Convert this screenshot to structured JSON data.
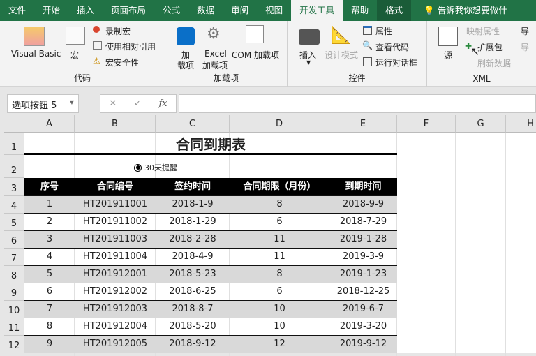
{
  "tabs": [
    "文件",
    "开始",
    "插入",
    "页面布局",
    "公式",
    "数据",
    "审阅",
    "视图",
    "开发工具",
    "帮助",
    "格式"
  ],
  "tell_me": "告诉我你想要做什",
  "ribbon": {
    "code": {
      "label": "代码",
      "visual_basic": "Visual Basic",
      "macro": "宏",
      "record_macro": "录制宏",
      "relative_ref": "使用相对引用",
      "macro_security": "宏安全性"
    },
    "addins": {
      "label": "加载项",
      "addins_1": "加",
      "addins_2": "载项",
      "excel_addins_1": "Excel",
      "excel_addins_2": "加载项",
      "com_addins": "COM 加载项"
    },
    "controls": {
      "label": "控件",
      "insert": "插入",
      "design_mode": "设计模式",
      "properties": "属性",
      "view_code": "查看代码",
      "run_dialog": "运行对话框"
    },
    "xml": {
      "label": "XML",
      "source": "源",
      "map_properties": "映射属性",
      "expansion_packs": "扩展包",
      "refresh_data": "刷新数据",
      "import": "导",
      "export": "导"
    }
  },
  "name_box": "选项按钮 5",
  "fx": "fx",
  "columns": [
    "A",
    "B",
    "C",
    "D",
    "E",
    "F",
    "G",
    "H"
  ],
  "rows": [
    "1",
    "2",
    "3",
    "4",
    "5",
    "6",
    "7",
    "8",
    "9",
    "10",
    "11",
    "12"
  ],
  "sheet": {
    "title": "合同到期表",
    "option_button": "30天提醒",
    "headers": [
      "序号",
      "合同编号",
      "签约时间",
      "合同期限（月份）",
      "到期时间"
    ],
    "data": [
      [
        "1",
        "HT201911001",
        "2018-1-9",
        "8",
        "2018-9-9"
      ],
      [
        "2",
        "HT201911002",
        "2018-1-29",
        "6",
        "2018-7-29"
      ],
      [
        "3",
        "HT201911003",
        "2018-2-28",
        "11",
        "2019-1-28"
      ],
      [
        "4",
        "HT201911004",
        "2018-4-9",
        "11",
        "2019-3-9"
      ],
      [
        "5",
        "HT201912001",
        "2018-5-23",
        "8",
        "2019-1-23"
      ],
      [
        "6",
        "HT201912002",
        "2018-6-25",
        "6",
        "2018-12-25"
      ],
      [
        "7",
        "HT201912003",
        "2018-8-7",
        "10",
        "2019-6-7"
      ],
      [
        "8",
        "HT201912004",
        "2018-5-20",
        "10",
        "2019-3-20"
      ],
      [
        "9",
        "HT201912005",
        "2018-9-12",
        "12",
        "2019-9-12"
      ]
    ]
  },
  "colors": {
    "accent": "#217346",
    "header_bg": "#000000",
    "stripe": "#d9d9d9"
  }
}
